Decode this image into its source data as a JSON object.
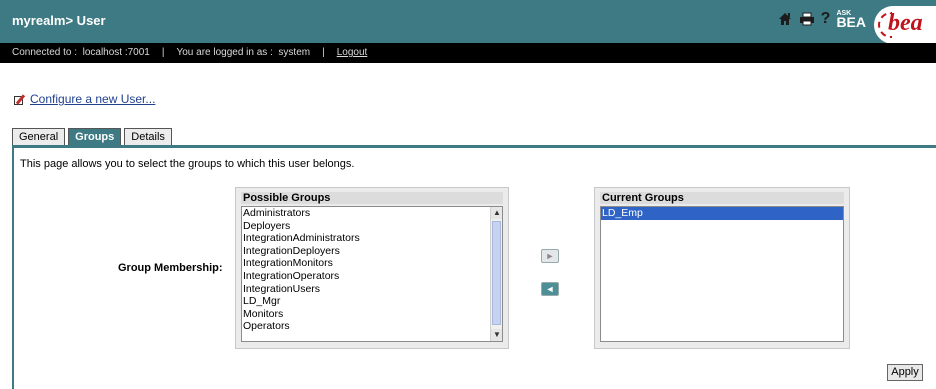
{
  "header": {
    "title": "myrealm> User",
    "icons": [
      "home-icon",
      "print-icon",
      "help-icon"
    ],
    "help_glyph": "?",
    "ask_bea_small": "ASK",
    "ask_bea": "BEA",
    "logo": "bea"
  },
  "status_bar": {
    "connected": "Connected to :  localhost :7001",
    "separator": "|",
    "logged_in": "You are logged in as :  system",
    "logout": "Logout"
  },
  "configure_link": "Configure a new User...",
  "tabs": [
    {
      "label": "General",
      "active": false
    },
    {
      "label": "Groups",
      "active": true
    },
    {
      "label": "Details",
      "active": false
    }
  ],
  "description": "This page allows you to select the groups to which this user belongs.",
  "membership_label": "Group Membership:",
  "possible_groups": {
    "header": "Possible Groups",
    "items": [
      "Administrators",
      "Deployers",
      "IntegrationAdministrators",
      "IntegrationDeployers",
      "IntegrationMonitors",
      "IntegrationOperators",
      "IntegrationUsers",
      "LD_Mgr",
      "Monitors",
      "Operators"
    ]
  },
  "current_groups": {
    "header": "Current Groups",
    "items": [
      "LD_Emp"
    ],
    "selected_index": 0
  },
  "move_buttons": {
    "add": "►",
    "remove": "◄"
  },
  "scroll": {
    "up": "▲",
    "down": "▼"
  },
  "apply_label": "Apply",
  "colors": {
    "header": "#3e7a84",
    "status_bar": "#000000",
    "selection": "#2f63c6",
    "link": "#21408e"
  }
}
